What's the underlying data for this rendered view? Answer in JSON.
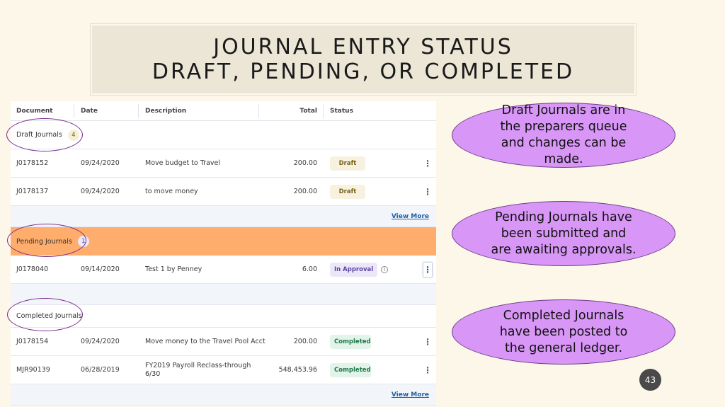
{
  "title": {
    "line1": "Journal Entry Status",
    "line2": "Draft, Pending, or Completed"
  },
  "table": {
    "headers": {
      "document": "Document",
      "date": "Date",
      "description": "Description",
      "total": "Total",
      "status": "Status"
    },
    "menu_glyph": "⋮",
    "view_more": "View More",
    "draft": {
      "label": "Draft Journals",
      "count": "4",
      "rows": [
        {
          "doc": "J0178152",
          "date": "09/24/2020",
          "desc": "Move budget to Travel",
          "total": "200.00",
          "status": "Draft"
        },
        {
          "doc": "J0178137",
          "date": "09/24/2020",
          "desc": "to move money",
          "total": "200.00",
          "status": "Draft"
        }
      ]
    },
    "pending": {
      "label": "Pending Journals",
      "count": "1",
      "rows": [
        {
          "doc": "J0178040",
          "date": "09/14/2020",
          "desc": "Test 1 by Penney",
          "total": "6.00",
          "status": "In Approval",
          "info_glyph": "i"
        }
      ]
    },
    "completed": {
      "label": "Completed Journals",
      "rows": [
        {
          "doc": "J0178154",
          "date": "09/24/2020",
          "desc": "Move money to the Travel Pool Acct",
          "total": "200.00",
          "status": "Completed"
        },
        {
          "doc": "MJR90139",
          "date": "06/28/2019",
          "desc": "FY2019 Payroll Reclass-through 6/30",
          "total": "548,453.96",
          "status": "Completed"
        }
      ]
    }
  },
  "callouts": {
    "draft": "Draft Journals are in the preparers queue and changes can be made.",
    "pending": "Pending Journals have been submitted and are awaiting approvals.",
    "completed": "Completed Journals have been posted to the general ledger."
  },
  "page_number": "43",
  "colors": {
    "pending_band": "#ffad6c",
    "callout_fill": "#d896f6",
    "highlight_ring": "#7a2a8c",
    "link": "#1f5fa8"
  }
}
